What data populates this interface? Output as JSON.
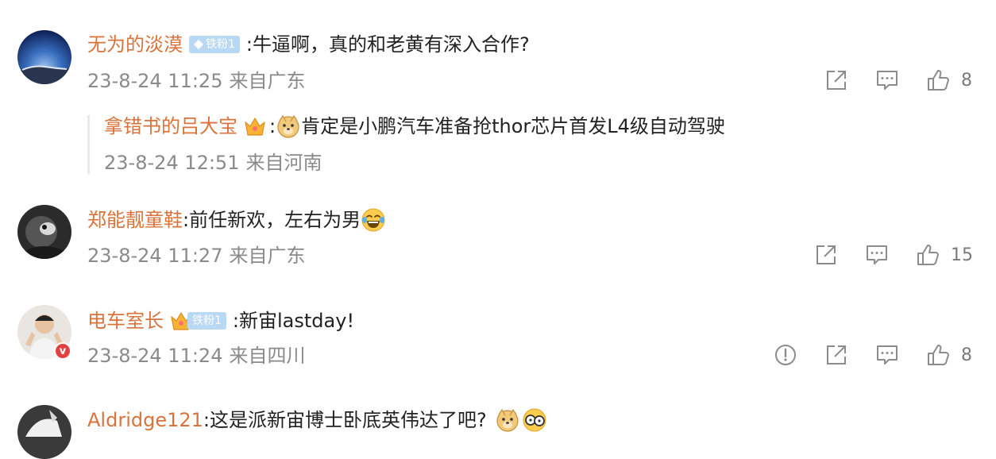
{
  "comments": [
    {
      "username": "无为的淡漠",
      "badge": "铁粉1",
      "text": ":牛逼啊，真的和老黄有深入合作?",
      "date": "23-8-24 11:25",
      "location": "来自广东",
      "likes": "8",
      "reply": {
        "username": "拿错书的吕大宝",
        "text": "肯定是小鹏汽车准备抢thor芯片首发L4级自动驾驶",
        "date": "23-8-24 12:51",
        "location": "来自河南"
      }
    },
    {
      "username": "郑能靓童鞋",
      "text": ":前任新欢，左右为男",
      "date": "23-8-24 11:27",
      "location": "来自广东",
      "likes": "15"
    },
    {
      "username": "电车室长",
      "badge": "铁粉1",
      "text": ":新宙lastday!",
      "date": "23-8-24 11:24",
      "location": "来自四川",
      "likes": "8",
      "verified": "v"
    },
    {
      "username": "Aldridge121",
      "text": ":这是派新宙博士卧底英伟达了吧?"
    }
  ],
  "colors": {
    "username": "#d9733b",
    "meta": "#8a8a8a",
    "badge_bg": "#b9d8f4",
    "verified": "#e2423f"
  },
  "icons": [
    "share-icon",
    "comment-icon",
    "like-icon",
    "report-icon",
    "crown-icon",
    "gem-icon"
  ]
}
